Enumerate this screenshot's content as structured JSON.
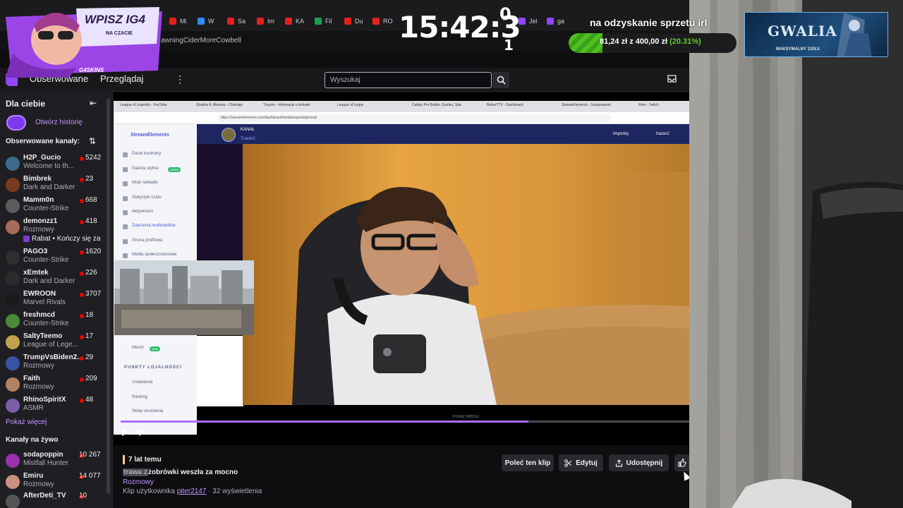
{
  "browser": {
    "tabs": [
      "Mi",
      "W",
      "Sa",
      "Im",
      "KA",
      "Fil",
      "Du",
      "RO",
      "ga",
      "Jel"
    ],
    "address_text": "awningCiderMoreCowbell"
  },
  "twitch": {
    "nav": {
      "following": "Obserwowane",
      "browse": "Przeglądaj",
      "more": "⋮"
    },
    "search": {
      "placeholder": "Wyszukaj"
    }
  },
  "sidebar": {
    "title": "Dla ciebie",
    "history_link": "Otwórz historię",
    "followed_title": "Obserwowane kanały:",
    "channels": [
      {
        "name": "H2P_Gucio",
        "game": "Welcome to th...",
        "viewers": "5242",
        "color": "#3e6b8c"
      },
      {
        "name": "Bimbrek",
        "game": "Dark and Darker",
        "viewers": "23",
        "color": "#7a3a1c"
      },
      {
        "name": "Mamm0n",
        "game": "Counter-Strike",
        "viewers": "668",
        "color": "#5c5c5c"
      },
      {
        "name": "demonzz1",
        "game": "Rozmowy",
        "viewers": "418",
        "color": "#a86c5a"
      },
      {
        "name": "PAGO3",
        "game": "Counter-Strike",
        "viewers": "1620",
        "color": "#2f2f2f"
      },
      {
        "name": "xEmtek",
        "game": "Dark and Darker",
        "viewers": "226",
        "color": "#2b2b2b"
      },
      {
        "name": "EWROON",
        "game": "Marvel Rivals",
        "viewers": "3707",
        "color": "#1b1b1b"
      },
      {
        "name": "freshmcd",
        "game": "Counter-Strike",
        "viewers": "18",
        "color": "#4b8a3b"
      },
      {
        "name": "SaltyTeemo",
        "game": "League of Lege...",
        "viewers": "17",
        "color": "#c2a14b"
      },
      {
        "name": "TrumpVsBiden2...",
        "game": "Rozmowy",
        "viewers": "29",
        "color": "#3954a5"
      },
      {
        "name": "Faith",
        "game": "Rozmowy",
        "viewers": "209",
        "color": "#b38260"
      },
      {
        "name": "RhinoSpiritX",
        "game": "ASMR",
        "viewers": "48",
        "color": "#7a5ea8"
      }
    ],
    "demonzz1_extra": "Rabat • Kończy się za",
    "show_more": "Pokaż więcej",
    "live_title": "Kanały na żywo",
    "live_channels": [
      {
        "name": "sodapoppin",
        "game": "Mistfall Hunter",
        "viewers": "10 267",
        "color": "#9b2fae"
      },
      {
        "name": "Emiru",
        "game": "Rozmowy",
        "viewers": "14 077",
        "color": "#c98f7f"
      },
      {
        "name": "AfterDeti_TV",
        "game": "",
        "viewers": "10",
        "color": "#555"
      }
    ]
  },
  "inner_browser": {
    "tabs": [
      "League of Legends - YouTube",
      "Shakira ft. Maluma - Chantaje",
      "Trayzer - Informacje o bohater",
      "League of Legos",
      "Caitlyn Pro Builds, Guides, Stat",
      "BetterTTV - Dashboard",
      "StreamElements - Songrequest",
      "Role - Twitch"
    ],
    "url": "https://streamelements.com/dashboard/mediarequest/general",
    "brand": "StreamElements",
    "channel_label": "KANAŁ",
    "channel_name": "Trazer2",
    "import_label": "Importuj",
    "user_label": "trazer2",
    "menu": [
      "Panel kontrolny",
      "Galeria stylów",
      "Moje nakładki",
      "Statystyki czatu",
      "Aktywności",
      "Zdarzenia multimediów",
      "Strona profilowa",
      "Media społecznościowe"
    ],
    "menu_badge": "NOWE",
    "merch": "Merch",
    "merch_badge": "NEW",
    "loyalty_title": "PUNKTY LOJALNOŚCI",
    "loyalty_items": [
      "Ustawienia",
      "Ranking",
      "Sklep strumienia"
    ],
    "show_more": "POKAŻ WIĘCEJ"
  },
  "player": {
    "progress": 0.717
  },
  "clip": {
    "ago": "7 lat temu",
    "title_highlight": "trawa z",
    "title_rest": "żobrówki weszła za mocno",
    "category": "Rozmowy",
    "by_prefix": "Klip użytkownika",
    "by_user": "piter2147",
    "views": "· 32 wyświetlenia",
    "buttons": {
      "recommend": "Poleć ten klip",
      "edit": "Edytuj",
      "share": "Udostępnij"
    }
  },
  "overlay": {
    "promo_title": "WPISZ IG4",
    "promo_sub": "NA CZACIE",
    "promo_brand": "G4SKINS",
    "clock": "15:42:3",
    "clock_top_digit": "0",
    "clock_bottom_digit": "1",
    "goal_title": "na odzyskanie sprzetu irl",
    "goal_amount": "81,24 zł",
    "goal_of": "z",
    "goal_target": "400,00 zł",
    "goal_pct": "(20.31%)",
    "goal_fraction": 0.2031,
    "gwalia_title": "GWALIA",
    "gwalia_sub": "MAKSYMALNY 120LV."
  }
}
